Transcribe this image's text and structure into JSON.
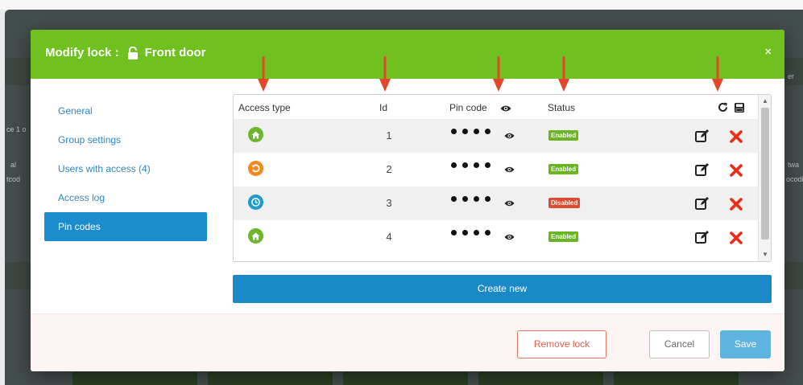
{
  "modal": {
    "title_prefix": "Modify lock :",
    "lock_name": "Front door",
    "close_label": "×"
  },
  "sidebar": {
    "items": [
      {
        "label": "General",
        "active": false
      },
      {
        "label": "Group settings",
        "active": false
      },
      {
        "label": "Users with access (4)",
        "active": false
      },
      {
        "label": "Access log",
        "active": false
      },
      {
        "label": "Pin codes",
        "active": true
      }
    ]
  },
  "table": {
    "headers": {
      "access_type": "Access type",
      "id": "Id",
      "pin_code": "Pin code",
      "status": "Status"
    },
    "rows": [
      {
        "access_icon": "home-icon",
        "access_color": "#6fb52c",
        "id": "1",
        "status": "Enabled",
        "status_color": "#6ab523"
      },
      {
        "access_icon": "recurring-icon",
        "access_color": "#f08a1e",
        "id": "2",
        "status": "Enabled",
        "status_color": "#6ab523"
      },
      {
        "access_icon": "clock-icon",
        "access_color": "#1e9bc9",
        "id": "3",
        "status": "Disabled",
        "status_color": "#e04a2f"
      },
      {
        "access_icon": "home-icon",
        "access_color": "#6fb52c",
        "id": "4",
        "status": "Enabled",
        "status_color": "#6ab523"
      }
    ]
  },
  "create_button": "Create new",
  "footer": {
    "remove_label": "Remove lock",
    "cancel_label": "Cancel",
    "save_label": "Save"
  },
  "colors": {
    "header_green": "#70c01f",
    "primary_blue": "#1a8ac7",
    "annotation_arrow": "#e2472b",
    "delete_red": "#ee2a12"
  },
  "background": {
    "fragments": [
      "ce 1 o",
      "al",
      "tcod",
      "twa",
      "ocodi",
      "er"
    ]
  }
}
